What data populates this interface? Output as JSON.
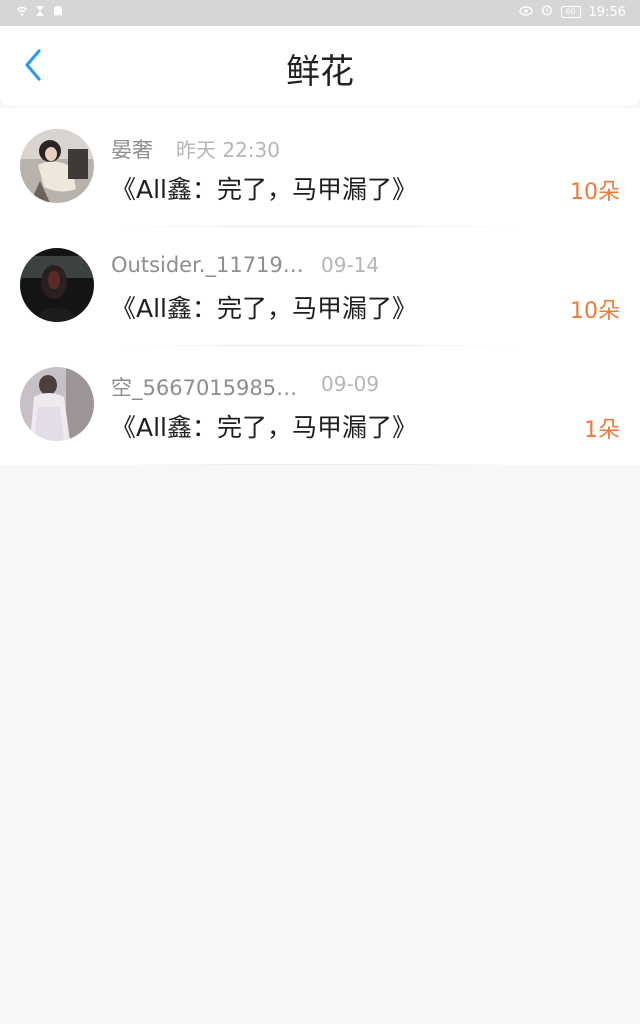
{
  "status_bar": {
    "time": "19:56",
    "battery": "60"
  },
  "header": {
    "title": "鲜花"
  },
  "items": [
    {
      "name": "晏奢",
      "time": "昨天 22:30",
      "title": "《All鑫：完了，马甲漏了》",
      "count": "10朵"
    },
    {
      "name": "Outsider._11719…",
      "time": "09-14",
      "title": "《All鑫：完了，马甲漏了》",
      "count": "10朵"
    },
    {
      "name": "空_5667015985…",
      "time": "09-09",
      "title": "《All鑫：完了，马甲漏了》",
      "count": "1朵"
    }
  ],
  "colors": {
    "accent": "#2d9cf0",
    "count": "#f07a35",
    "status_bar": "#d6d6d6"
  }
}
